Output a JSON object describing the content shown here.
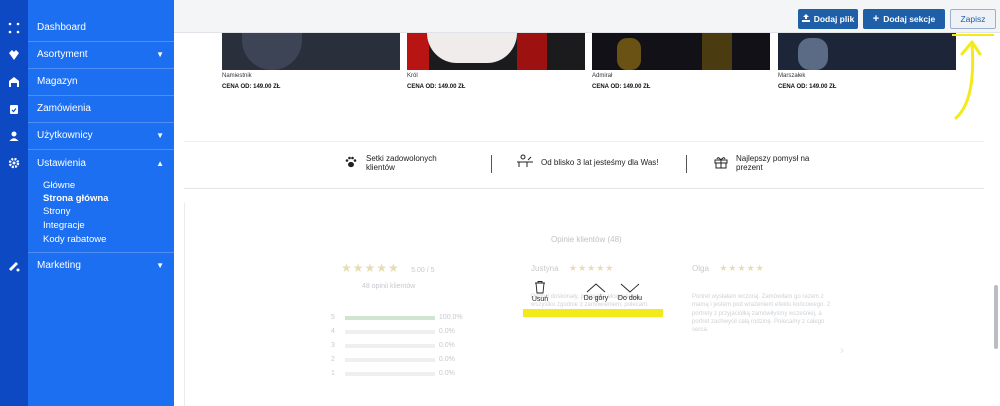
{
  "sidebar": {
    "items": [
      {
        "label": "Dashboard",
        "icon": "dashboard-icon"
      },
      {
        "label": "Asortyment",
        "icon": "assortment-icon",
        "caret": "▼"
      },
      {
        "label": "Magazyn",
        "icon": "warehouse-icon"
      },
      {
        "label": "Zamówienia",
        "icon": "orders-icon"
      },
      {
        "label": "Użytkownicy",
        "icon": "users-icon",
        "caret": "▼"
      },
      {
        "label": "Ustawienia",
        "icon": "settings-icon",
        "caret": "▲"
      },
      {
        "label": "Marketing",
        "icon": "marketing-icon",
        "caret": "▼"
      }
    ],
    "settings_sub": [
      "Główne",
      "Strona główna",
      "Strony",
      "Integracje",
      "Kody rabatowe"
    ]
  },
  "toolbar": {
    "add_file": "Dodaj plik",
    "add_section": "Dodaj sekcje",
    "save": "Zapisz"
  },
  "products": [
    {
      "name": "Namiestnik",
      "price": "CENA OD:    149.00 ZŁ"
    },
    {
      "name": "Król",
      "price": "CENA OD:    149.00 ZŁ"
    },
    {
      "name": "Admirał",
      "price": "CENA OD:    149.00 ZŁ"
    },
    {
      "name": "Marszałek",
      "price": "CENA OD:    149.00 ZŁ"
    }
  ],
  "features": [
    {
      "text": "Setki zadowolonych klientów",
      "icon": "paw-icon"
    },
    {
      "text": "Od blisko 3 lat jesteśmy dla Was!",
      "icon": "person-desk-icon"
    },
    {
      "text": "Najlepszy pomysł na prezent",
      "icon": "gift-icon"
    }
  ],
  "reviews": {
    "title": "Opinie klientów (48)",
    "stars": "★★★★★",
    "score": "5.00 / 5",
    "count": "48 opinii klientów",
    "breakdown": [
      {
        "rating": "5",
        "percent": "100.0%",
        "fill": 1.0
      },
      {
        "rating": "4",
        "percent": "0.0%",
        "fill": 0
      },
      {
        "rating": "3",
        "percent": "0.0%",
        "fill": 0
      },
      {
        "rating": "2",
        "percent": "0.0%",
        "fill": 0
      },
      {
        "rating": "1",
        "percent": "0.0%",
        "fill": 0
      }
    ],
    "cards": [
      {
        "author": "Justyna",
        "text": "Portret doskonały, przesyłka ekspresowo, wszystko zgodnie z zamówieniem, polecam."
      },
      {
        "author": "Olga",
        "text": "Portret wysłałam wczoraj. Zamówiłam go razem z mamą i jestem pod wrażeniem efektu końcowego. 2 portrety z przyjaciółką zamówiłyśmy wcześniej, a portret zachwycił całą rodzinę. Polecamy z całego serca."
      }
    ]
  },
  "overlay": {
    "delete": "Usuń",
    "up": "Do góry",
    "down": "Do dołu"
  },
  "colors": {
    "sidebar": "#1d6ff2",
    "rail": "#0d49c2",
    "primary_button": "#1f5fa8",
    "highlight": "#f2ea1a"
  }
}
